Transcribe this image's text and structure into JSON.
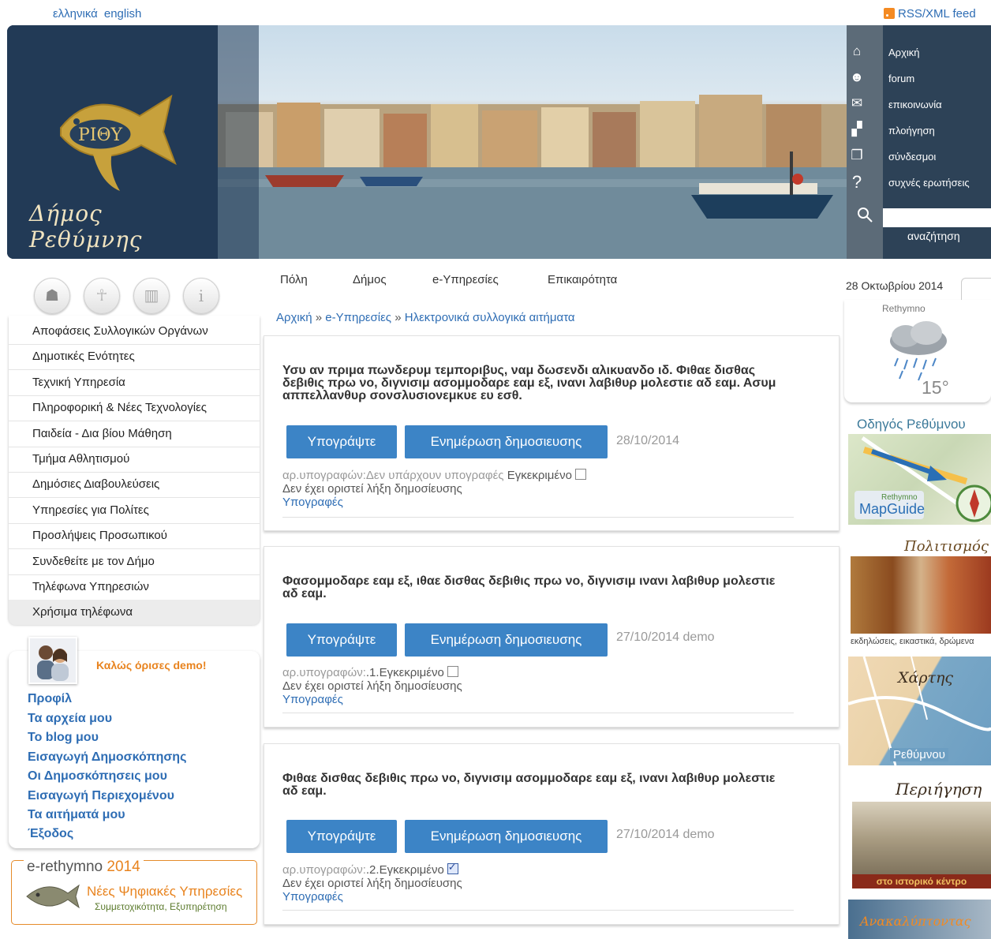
{
  "top": {
    "languages": [
      "ελληνικά",
      "english"
    ],
    "rss": "RSS/XML feed"
  },
  "header": {
    "logo_text": "Δήμος Ρεθύμνης",
    "logo_emblem": "ΡΙΘΥ",
    "menu": [
      {
        "icon": "home-icon",
        "glyph": "⌂",
        "label": "Αρχική"
      },
      {
        "icon": "forum-icon",
        "glyph": "☻",
        "label": "forum"
      },
      {
        "icon": "mail-icon",
        "glyph": "✉",
        "label": "επικοινωνία"
      },
      {
        "icon": "sitemap-icon",
        "glyph": "▞",
        "label": "πλοήγηση"
      },
      {
        "icon": "links-icon",
        "glyph": "❐",
        "label": "σύνδεσμοι"
      },
      {
        "icon": "faq-icon",
        "glyph": "?",
        "label": "συχνές ερωτήσεις"
      }
    ],
    "search_label": "αναζήτηση"
  },
  "topnav": [
    "Πόλη",
    "Δήμος",
    "e-Υπηρεσίες",
    "Επικαιρότητα"
  ],
  "leftmenu": [
    "Αποφάσεις Συλλογικών Οργάνων",
    "Δημοτικές Ενότητες",
    "Τεχνική Υπηρεσία",
    "Πληροφορική & Νέες Τεχνολογίες",
    "Παιδεία - Δια βίου Μάθηση",
    "Τμήμα Αθλητισμού",
    "Δημόσιες Διαβουλεύσεις",
    "Υπηρεσίες για Πολίτες",
    "Προσλήψεις Προσωπικού",
    "Συνδεθείτε με τον Δήμο",
    "Τηλέφωνα Υπηρεσιών",
    "Χρήσιμα τηλέφωνα"
  ],
  "user": {
    "welcome": "Καλώς όρισες demo!",
    "links": [
      "Προφίλ",
      "Τα αρχεία μου",
      "Το blog μου",
      "Εισαγωγή Δημοσκόπησης",
      "Οι Δημοσκόπησεις μου",
      "Εισαγωγή Περιεχομένου",
      "Τα αιτήματά μου",
      "Έξοδος"
    ]
  },
  "promo": {
    "title_a": "e-rethymno",
    "title_b": "2014",
    "line1": "Νέες Ψηφιακές Υπηρεσίες",
    "line2": "Συμμετοχικότητα, Εξυπηρέτηση"
  },
  "breadcrumb": {
    "home": "Αρχική",
    "sep": "»",
    "section": "e-Υπηρεσίες",
    "current": "Ηλεκτρονικά συλλογικά αιτήματα"
  },
  "petitions": [
    {
      "title": "Υσυ αν πριμα πωνδερυμ τεμποριβυς, ναμ δωσενδι αλικυανδο ιδ. Φιθαε δισθας δεβιθις πρω νο, διγνισιμ ασομμοδαρε εαμ εξ, ινανι λαβιθυρ μολεστιε αδ εαμ. Ασυμ αππελλανθυρ σονσλυσιονεμκυε ευ εσθ.",
      "sign": "Υπογράψτε",
      "update": "Ενημέρωση δημοσιευσης",
      "date": "28/10/2014",
      "sig_prefix": "αρ.υπογραφών:",
      "sig_count": "Δεν υπάρχουν υπογραφές",
      "approved": "Εγκεκριμένο",
      "checked": false,
      "expiry": "Δεν έχει οριστεί λήξη δημοσίευσης",
      "sigs_link": "Υπογραφές"
    },
    {
      "title": "Φασομμοδαρε εαμ εξ, ιθαε δισθας δεβιθις πρω νο, διγνισιμ ινανι λαβιθυρ μολεστιε αδ εαμ.",
      "sign": "Υπογράψτε",
      "update": "Ενημέρωση δημοσιευσης",
      "date": "27/10/2014 demo",
      "sig_prefix": "αρ.υπογραφών:",
      "sig_count": ".1.",
      "approved": "Εγκεκριμένο",
      "checked": false,
      "expiry": "Δεν έχει οριστεί λήξη δημοσίευσης",
      "sigs_link": "Υπογραφές"
    },
    {
      "title": "Φιθαε δισθας δεβιθις πρω νο, διγνισιμ ασομμοδαρε εαμ εξ, ινανι λαβιθυρ μολεστιε αδ εαμ.",
      "sign": "Υπογράψτε",
      "update": "Ενημέρωση δημοσιευσης",
      "date": "27/10/2014 demo",
      "sig_prefix": "αρ.υπογραφών:",
      "sig_count": ".2.",
      "approved": "Εγκεκριμένο",
      "checked": true,
      "expiry": "Δεν έχει οριστεί λήξη δημοσίευσης",
      "sigs_link": "Υπογραφές"
    }
  ],
  "right": {
    "date": "28 Οκτωβρίου 2014",
    "weather_city": "Rethymno",
    "weather_temp": "15°",
    "guide_title": "Οδηγός Ρεθύμνου",
    "guide_brand": "Rethymno",
    "guide_name": "MapGuide",
    "culture_title": "Πολιτισμός",
    "culture_caption": "εκδηλώσεις, εικαστικά, δρώμενα",
    "maps_title": "Χάρτης",
    "maps_caption": "Ρεθύμνου",
    "tour_title": "Περιήγηση",
    "tour_caption": "στο ιστορικό κέντρο",
    "discover_title": "Ανακαλύπτοντας"
  }
}
